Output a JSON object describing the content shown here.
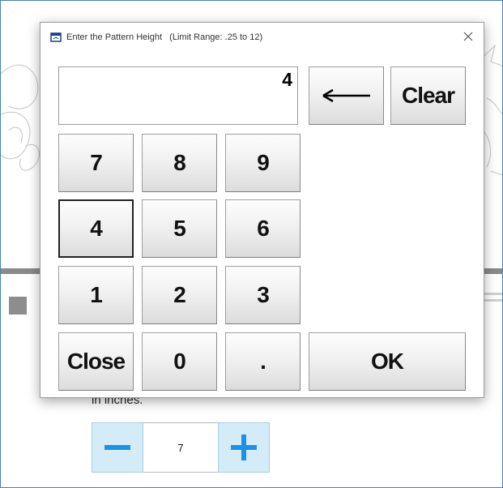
{
  "dialog": {
    "title": "Enter the Pattern Height   (Limit Range: .25 to 12)",
    "display_value": "4",
    "keys": {
      "backspace": "←",
      "clear": "Clear",
      "k7": "7",
      "k8": "8",
      "k9": "9",
      "k4": "4",
      "k5": "5",
      "k6": "6",
      "k1": "1",
      "k2": "2",
      "k3": "3",
      "close": "Close",
      "k0": "0",
      "dot": ".",
      "ok": "OK"
    },
    "close_icon": "close-icon"
  },
  "background": {
    "units_label": "in inches.",
    "stepper_value": "7",
    "minus_icon": "minus-icon",
    "plus_icon": "plus-icon",
    "accent_color": "#1e90e6"
  }
}
